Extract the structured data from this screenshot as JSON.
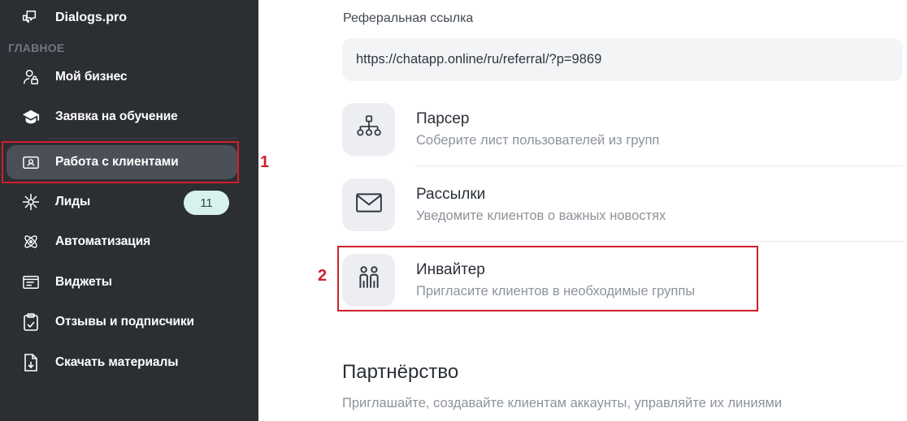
{
  "sidebar": {
    "brand": {
      "label": "Dialogs.pro",
      "icon": "chat-bubbles-icon"
    },
    "section_title": "ГЛАВНОЕ",
    "items": [
      {
        "label": "Мой бизнес",
        "icon": "user-lock-icon"
      },
      {
        "label": "Заявка на обучение",
        "icon": "graduation-cap-icon"
      },
      {
        "label": "Работа с клиентами",
        "icon": "contact-card-icon",
        "active": true
      },
      {
        "label": "Лиды",
        "icon": "network-icon",
        "badge": "11"
      },
      {
        "label": "Автоматизация",
        "icon": "atom-icon"
      },
      {
        "label": "Виджеты",
        "icon": "widget-window-icon"
      },
      {
        "label": "Отзывы и подписчики",
        "icon": "clipboard-check-icon"
      },
      {
        "label": "Скачать материалы",
        "icon": "file-download-icon"
      }
    ]
  },
  "annotations": {
    "marker_1": "1",
    "marker_2": "2",
    "highlight_color": "#d21f2b"
  },
  "main": {
    "referral": {
      "label": "Реферальная ссылка",
      "value": "https://chatapp.online/ru/referral/?p=9869"
    },
    "tools": [
      {
        "title": "Парсер",
        "subtitle": "Соберите лист пользователей из групп",
        "icon": "hierarchy-icon"
      },
      {
        "title": "Рассылки",
        "subtitle": "Уведомите клиентов о важных новостях",
        "icon": "envelope-icon"
      },
      {
        "title": "Инвайтер",
        "subtitle": "Пригласите клиентов в необходимые группы",
        "icon": "people-icon"
      }
    ],
    "partnership": {
      "title": "Партнёрство",
      "subtitle": "Приглашайте, создавайте клиентам аккаунты, управляйте их линиями"
    }
  },
  "colors": {
    "sidebar_bg": "#2b2e33",
    "active_item_bg": "#4b5058",
    "badge_bg": "#d6f1ee",
    "tile_bg": "#eceef2"
  }
}
